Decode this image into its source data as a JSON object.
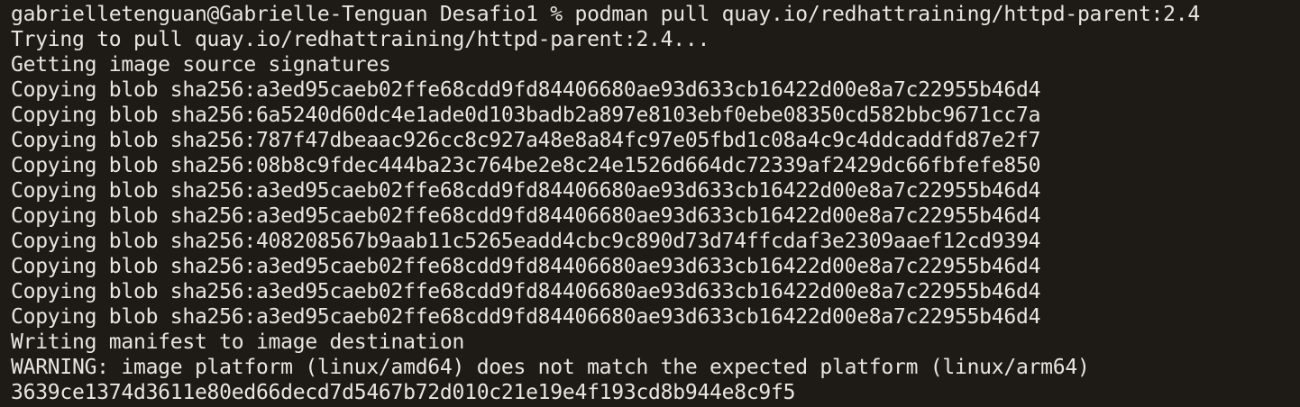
{
  "terminal": {
    "lines": [
      "gabrielletenguan@Gabrielle-Tenguan Desafio1 % podman pull quay.io/redhattraining/httpd-parent:2.4",
      "Trying to pull quay.io/redhattraining/httpd-parent:2.4...",
      "Getting image source signatures",
      "Copying blob sha256:a3ed95caeb02ffe68cdd9fd84406680ae93d633cb16422d00e8a7c22955b46d4",
      "Copying blob sha256:6a5240d60dc4e1ade0d103badb2a897e8103ebf0ebe08350cd582bbc9671cc7a",
      "Copying blob sha256:787f47dbeaac926cc8c927a48e8a84fc97e05fbd1c08a4c9c4ddcaddfd87e2f7",
      "Copying blob sha256:08b8c9fdec444ba23c764be2e8c24e1526d664dc72339af2429dc66fbfefe850",
      "Copying blob sha256:a3ed95caeb02ffe68cdd9fd84406680ae93d633cb16422d00e8a7c22955b46d4",
      "Copying blob sha256:a3ed95caeb02ffe68cdd9fd84406680ae93d633cb16422d00e8a7c22955b46d4",
      "Copying blob sha256:408208567b9aab11c5265eadd4cbc9c890d73d74ffcdaf3e2309aaef12cd9394",
      "Copying blob sha256:a3ed95caeb02ffe68cdd9fd84406680ae93d633cb16422d00e8a7c22955b46d4",
      "Copying blob sha256:a3ed95caeb02ffe68cdd9fd84406680ae93d633cb16422d00e8a7c22955b46d4",
      "Copying blob sha256:a3ed95caeb02ffe68cdd9fd84406680ae93d633cb16422d00e8a7c22955b46d4",
      "Writing manifest to image destination",
      "WARNING: image platform (linux/amd64) does not match the expected platform (linux/arm64)",
      "3639ce1374d3611e80ed66decd7d5467b72d010c21e19e4f193cd8b944e8c9f5"
    ],
    "colors": {
      "background": "#1e1b16",
      "foreground": "#e8e6e1"
    }
  }
}
